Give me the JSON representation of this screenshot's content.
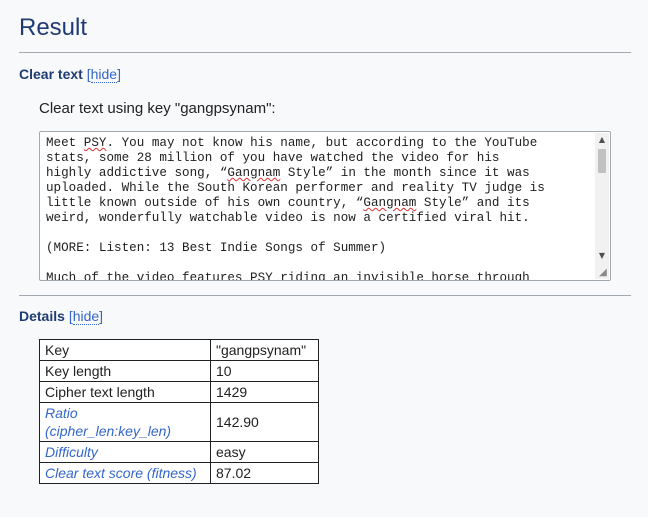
{
  "result": {
    "title": "Result"
  },
  "clear_text_section": {
    "heading": "Clear text",
    "hide_label": "hide",
    "bracket_open": "[",
    "bracket_close": "]",
    "label": "Clear text using key \"gangpsynam\":",
    "lines": [
      {
        "pre": "Meet ",
        "spell": "PSY",
        "post": ". You may not know his name, but according to the YouTube"
      },
      {
        "pre": "stats, some 28 million of you have watched the video for his",
        "spell": "",
        "post": ""
      },
      {
        "pre": "highly addictive song, “",
        "spell": "Gangnam",
        "post": " Style” in the month since it was"
      },
      {
        "pre": "uploaded. While the South Korean performer and reality TV judge is",
        "spell": "",
        "post": ""
      },
      {
        "pre": "little known outside of his own country, “",
        "spell": "Gangnam",
        "post": " Style” and its"
      },
      {
        "pre": "weird, wonderfully watchable video is now a certified viral hit.",
        "spell": "",
        "post": ""
      },
      {
        "pre": "",
        "spell": "",
        "post": ""
      },
      {
        "pre": "(MORE: Listen: 13 Best Indie Songs of Summer)",
        "spell": "",
        "post": ""
      },
      {
        "pre": "",
        "spell": "",
        "post": ""
      },
      {
        "pre": "Much of the video features PSY riding an invisible horse through",
        "spell": "",
        "post": ""
      }
    ]
  },
  "details_section": {
    "heading": "Details",
    "hide_label": "hide",
    "bracket_open": "[",
    "bracket_close": "]",
    "rows": [
      {
        "key": "Key",
        "value": "\"gangpsynam\"",
        "italic": false
      },
      {
        "key": "Key length",
        "value": "10",
        "italic": false
      },
      {
        "key": "Cipher text length",
        "value": "1429",
        "italic": false
      },
      {
        "key": "Ratio (cipher_len:key_len)",
        "key_line1": "Ratio",
        "key_line2": "(cipher_len:key_len)",
        "value": "142.90",
        "italic": true
      },
      {
        "key": "Difficulty",
        "value": "easy",
        "italic": true
      },
      {
        "key": "Clear text score (fitness)",
        "value": "87.02",
        "italic": true
      }
    ]
  },
  "icons": {
    "scroll_up": "triangle-up-icon",
    "scroll_down": "triangle-down-icon",
    "resize": "resize-grip-icon"
  },
  "colors": {
    "heading": "#1f3b73",
    "link": "#3366cc",
    "background": "#f8f9fa",
    "divider": "#a2a9b1"
  }
}
